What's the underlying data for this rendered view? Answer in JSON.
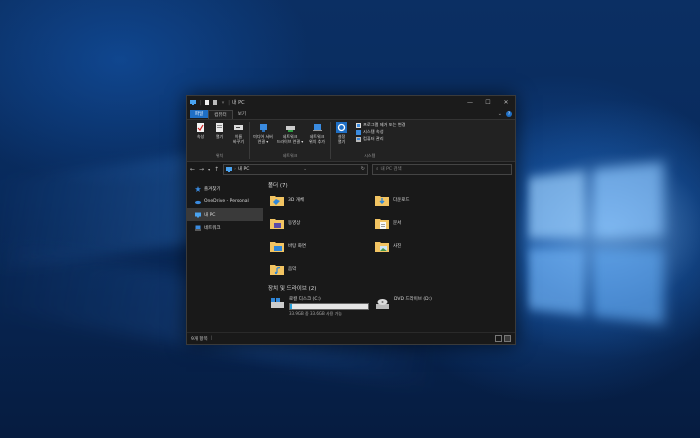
{
  "window": {
    "title": "내 PC"
  },
  "window_controls": [
    "—",
    "☐",
    "✕"
  ],
  "menu": {
    "file": "파일",
    "computer": "컴퓨터",
    "view": "보기"
  },
  "ribbon": {
    "location": {
      "name": "위치",
      "items": [
        {
          "label": "속성",
          "icon": "properties-icon"
        },
        {
          "label": "열기",
          "icon": "open-icon"
        },
        {
          "label": "이름\n바꾸기",
          "icon": "rename-icon"
        }
      ]
    },
    "network": {
      "name": "네트워크",
      "items": [
        {
          "label": "미디어 서버\n연결 ▾",
          "icon": "media-server-icon"
        },
        {
          "label": "네트워크\n드라이브 연결 ▾",
          "icon": "map-drive-icon"
        },
        {
          "label": "네트워크\n위치 추가",
          "icon": "add-network-location-icon"
        }
      ]
    },
    "system": {
      "name": "시스템",
      "settings": {
        "label": "설정\n열기",
        "icon": "settings-gear-icon"
      },
      "items": [
        {
          "label": "프로그램 제거 또는 변경",
          "icon": "uninstall-icon"
        },
        {
          "label": "시스템 속성",
          "icon": "system-properties-icon"
        },
        {
          "label": "컴퓨터 관리",
          "icon": "computer-management-icon"
        }
      ]
    }
  },
  "address": {
    "path": "내 PC",
    "search_placeholder": "내 PC 검색"
  },
  "nav": [
    {
      "label": "즐겨찾기",
      "icon": "star-icon"
    },
    {
      "label": "OneDrive - Personal",
      "icon": "onedrive-icon"
    },
    {
      "label": "내 PC",
      "icon": "pc-icon",
      "selected": true
    },
    {
      "label": "네트워크",
      "icon": "network-icon"
    }
  ],
  "folders_section": "폴더 (7)",
  "folders": [
    {
      "label": "3D 개체",
      "icon": "3d-objects-icon"
    },
    {
      "label": "다운로드",
      "icon": "downloads-folder-icon"
    },
    {
      "label": "동영상",
      "icon": "videos-folder-icon"
    },
    {
      "label": "문서",
      "icon": "documents-folder-icon"
    },
    {
      "label": "바탕 화면",
      "icon": "desktop-folder-icon"
    },
    {
      "label": "사진",
      "icon": "pictures-folder-icon"
    },
    {
      "label": "음악",
      "icon": "music-folder-icon"
    }
  ],
  "drives_section": "장치 및 드라이브 (2)",
  "drives": [
    {
      "label": "로컬 디스크 (C:)",
      "free": "33.9GB 중 33.6GB 사용 가능",
      "used_fraction": 0.01,
      "icon": "local-disk-icon"
    },
    {
      "label": "DVD 드라이브 (D:)",
      "icon": "dvd-drive-icon"
    }
  ],
  "status": {
    "items": "9개 항목"
  },
  "colors": {
    "accent": "#1f6fc5",
    "folder": "#f2c462",
    "bar_fill": "#26a0da"
  }
}
